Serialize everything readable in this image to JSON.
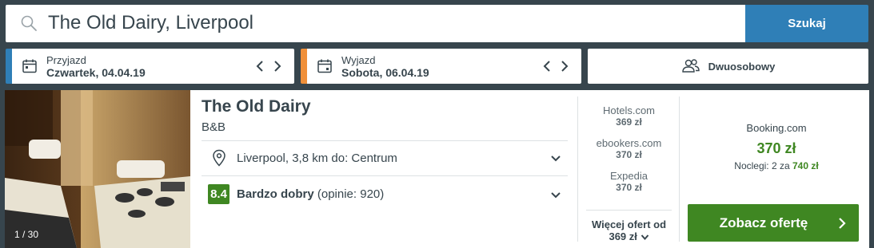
{
  "search": {
    "query": "The Old Dairy, Liverpool",
    "button_label": "Szukaj"
  },
  "dates": {
    "checkin": {
      "label": "Przyjazd",
      "value": "Czwartek, 04.04.19"
    },
    "checkout": {
      "label": "Wyjazd",
      "value": "Sobota, 06.04.19"
    }
  },
  "room": {
    "label": "Dwuosobowy"
  },
  "hotel": {
    "name": "The Old Dairy",
    "type": "B&B",
    "photo_count": "1 / 30",
    "location": "Liverpool, 3,8 km do: Centrum",
    "rating_score": "8.4",
    "rating_label": "Bardzo dobry",
    "rating_reviews": "(opinie: 920)"
  },
  "offers": [
    {
      "provider": "Hotels.com",
      "price": "369 zł"
    },
    {
      "provider": "ebookers.com",
      "price": "370 zł"
    },
    {
      "provider": "Expedia",
      "price": "370 zł"
    }
  ],
  "more_offers": {
    "label": "Więcej ofert od",
    "price": "369 zł"
  },
  "best_offer": {
    "provider": "Booking.com",
    "price": "370 zł",
    "nights_label": "Noclegi: 2 za",
    "total": "740 zł",
    "button_label": "Zobacz ofertę"
  },
  "colors": {
    "accent_blue": "#2f7fb7",
    "accent_orange": "#f0903a",
    "deal_green": "#3f8722",
    "header_bg": "#37454d"
  },
  "icons": [
    "search-icon",
    "calendar-icon",
    "chevron-left-icon",
    "chevron-right-icon",
    "people-icon",
    "map-pin-icon",
    "chevron-down-icon",
    "chevron-right-icon"
  ]
}
